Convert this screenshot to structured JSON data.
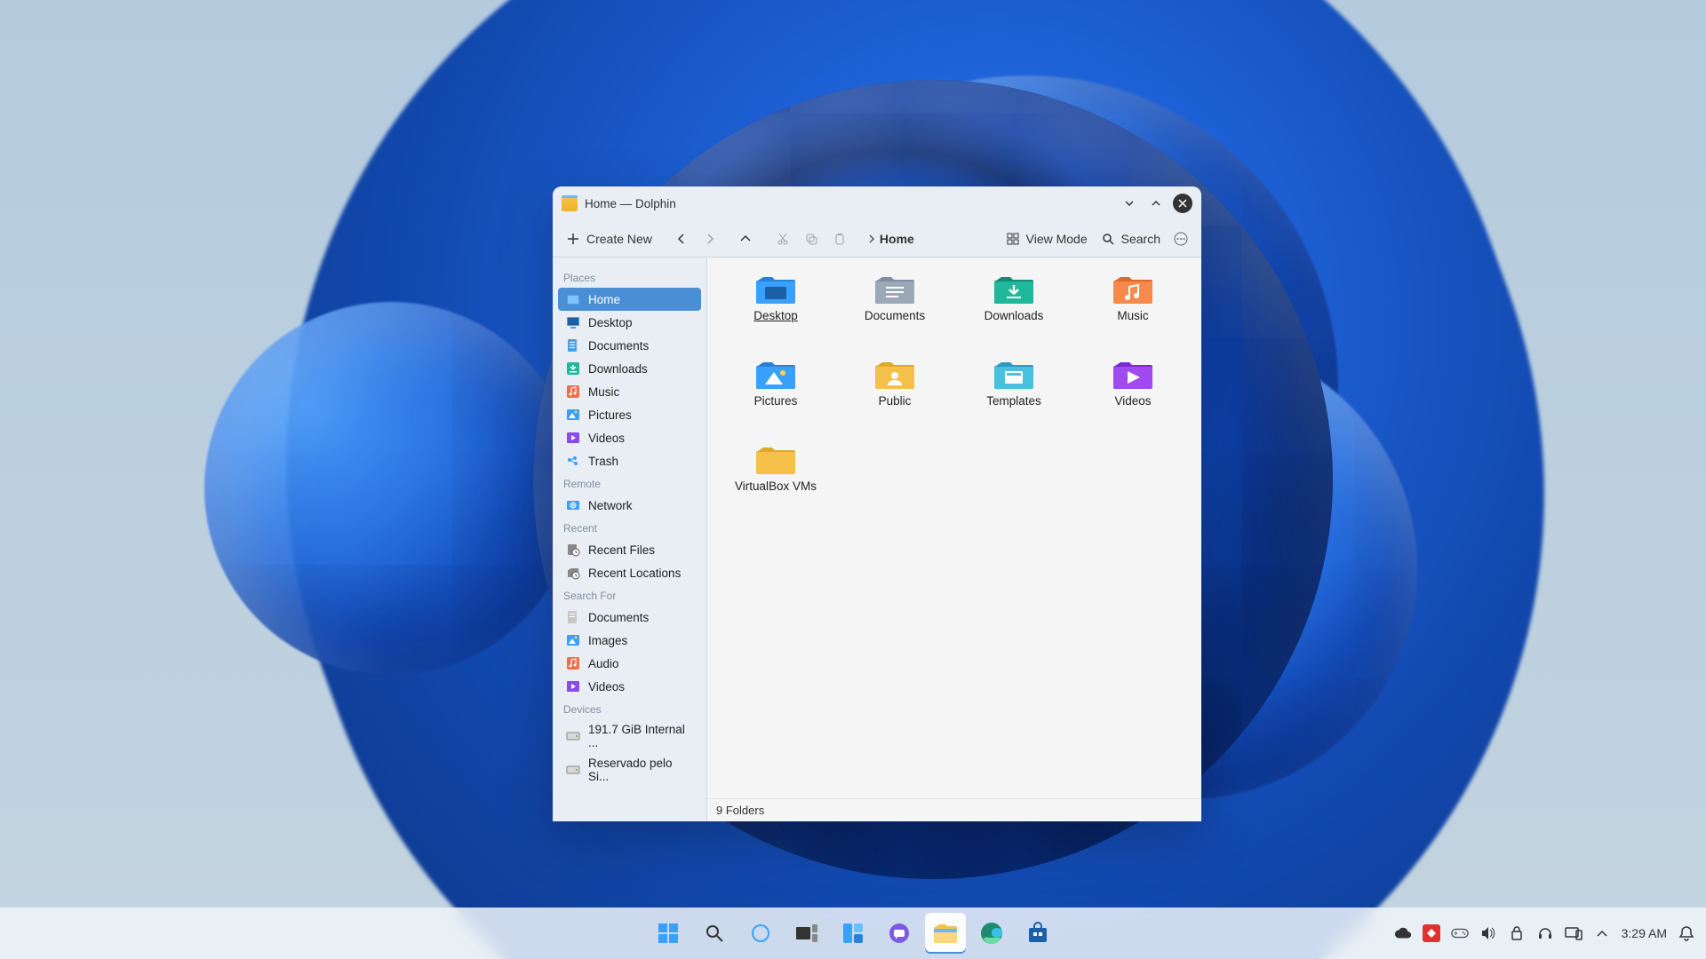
{
  "window": {
    "title": "Home — Dolphin",
    "toolbar": {
      "createNew": "Create New",
      "viewMode": "View Mode",
      "search": "Search"
    },
    "breadcrumb": {
      "current": "Home"
    },
    "statusbar": "9 Folders",
    "sidebar": {
      "sections": [
        {
          "title": "Places",
          "items": [
            {
              "label": "Home",
              "icon": "home",
              "selected": true
            },
            {
              "label": "Desktop",
              "icon": "desktop"
            },
            {
              "label": "Documents",
              "icon": "documents"
            },
            {
              "label": "Downloads",
              "icon": "downloads"
            },
            {
              "label": "Music",
              "icon": "music"
            },
            {
              "label": "Pictures",
              "icon": "pictures"
            },
            {
              "label": "Videos",
              "icon": "videos"
            },
            {
              "label": "Trash",
              "icon": "trash"
            }
          ]
        },
        {
          "title": "Remote",
          "items": [
            {
              "label": "Network",
              "icon": "network"
            }
          ]
        },
        {
          "title": "Recent",
          "items": [
            {
              "label": "Recent Files",
              "icon": "recent-files"
            },
            {
              "label": "Recent Locations",
              "icon": "recent-locations"
            }
          ]
        },
        {
          "title": "Search For",
          "items": [
            {
              "label": "Documents",
              "icon": "documents-s"
            },
            {
              "label": "Images",
              "icon": "pictures"
            },
            {
              "label": "Audio",
              "icon": "music"
            },
            {
              "label": "Videos",
              "icon": "videos"
            }
          ]
        },
        {
          "title": "Devices",
          "items": [
            {
              "label": "191.7 GiB Internal ...",
              "icon": "drive"
            },
            {
              "label": "Reservado pelo Si...",
              "icon": "drive"
            }
          ]
        }
      ]
    },
    "files": [
      {
        "label": "Desktop",
        "icon": "desktop-folder",
        "underline": true
      },
      {
        "label": "Documents",
        "icon": "documents-folder"
      },
      {
        "label": "Downloads",
        "icon": "downloads-folder"
      },
      {
        "label": "Music",
        "icon": "music-folder"
      },
      {
        "label": "Pictures",
        "icon": "pictures-folder"
      },
      {
        "label": "Public",
        "icon": "public-folder"
      },
      {
        "label": "Templates",
        "icon": "templates-folder"
      },
      {
        "label": "Videos",
        "icon": "videos-folder"
      },
      {
        "label": "VirtualBox VMs",
        "icon": "plain-folder"
      }
    ]
  },
  "taskbar": {
    "items": [
      {
        "name": "start",
        "icon": "start"
      },
      {
        "name": "search",
        "icon": "search"
      },
      {
        "name": "cortana",
        "icon": "cortana"
      },
      {
        "name": "taskview",
        "icon": "taskview"
      },
      {
        "name": "widgets",
        "icon": "widgets"
      },
      {
        "name": "chat",
        "icon": "chat"
      },
      {
        "name": "explorer",
        "icon": "explorer",
        "active": true
      },
      {
        "name": "edge",
        "icon": "edge"
      },
      {
        "name": "store",
        "icon": "store"
      }
    ]
  },
  "tray": {
    "time": "3:29 AM",
    "icons": [
      "cloud",
      "anydesk",
      "gamepad",
      "volume",
      "lock",
      "headset",
      "device",
      "chevron-up"
    ]
  }
}
